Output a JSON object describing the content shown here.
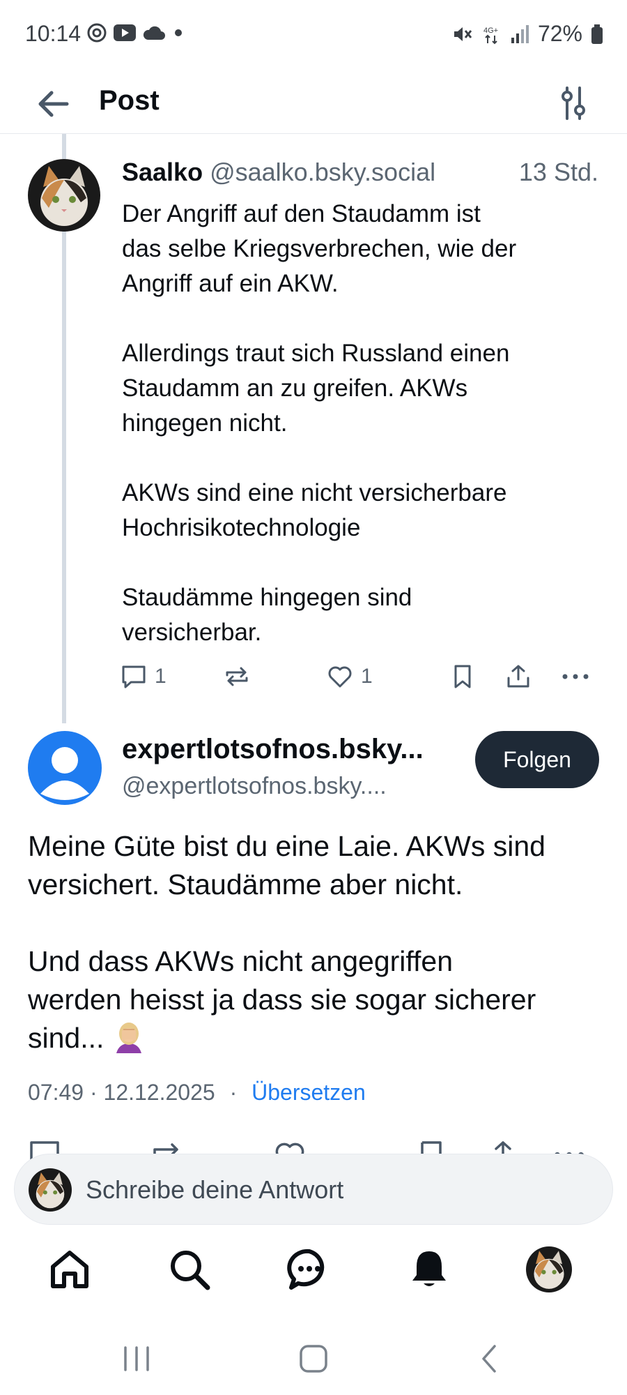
{
  "status_bar": {
    "time": "10:14",
    "network": "4G+",
    "battery": "72%"
  },
  "header": {
    "title": "Post"
  },
  "parent_post": {
    "author_name": "Saalko",
    "author_handle": "@saalko.bsky.social",
    "time": "13 Std.",
    "paragraphs": [
      [
        "Der Angriff auf den Staudamm ist",
        "das selbe Kriegsverbrechen, wie der",
        "Angriff auf ein AKW."
      ],
      [
        "Allerdings traut sich Russland einen",
        "Staudamm an zu greifen. AKWs",
        "hingegen nicht."
      ],
      [
        "AKWs sind eine nicht versicherbare",
        "Hochrisikotechnologie"
      ],
      [
        "Staudämme hingegen sind",
        "versicherbar."
      ]
    ],
    "reply_count": "1",
    "like_count": "1"
  },
  "main_post": {
    "author_name": "expertlotsofnos.bsky...",
    "author_handle": "@expertlotsofnos.bsky....",
    "follow_label": "Folgen",
    "paragraphs": [
      [
        "Meine Güte bist du eine Laie. AKWs sind",
        "versichert. Staudämme aber nicht."
      ],
      [
        "Und dass AKWs nicht angegriffen",
        "werden heisst ja dass sie sogar sicherer",
        "sind... "
      ]
    ],
    "emoji": "face-palm-emoji",
    "timestamp": "07:49 · 12.12.2025",
    "separator": "·",
    "translate_label": "Übersetzen"
  },
  "composer": {
    "placeholder": "Schreibe deine Antwort"
  },
  "colors": {
    "accent": "#1f7cf0",
    "follow_button": "#1e2936",
    "muted_text": "#5b6672",
    "thread_line": "#d4dbe3"
  },
  "icons": {
    "nav": [
      "home-icon",
      "search-icon",
      "chat-icon",
      "bell-icon",
      "profile-avatar"
    ]
  }
}
